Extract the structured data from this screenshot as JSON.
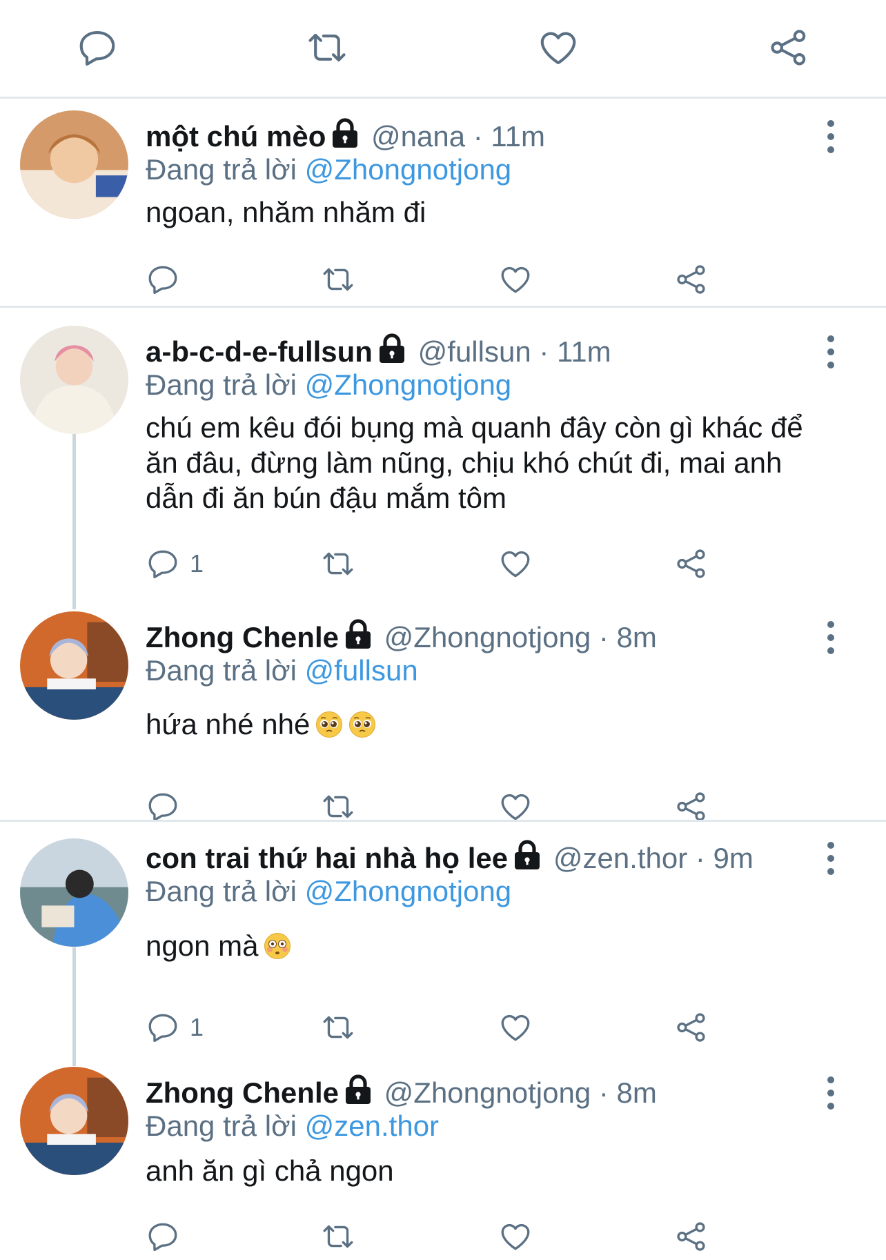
{
  "top_actions": [
    "reply-icon",
    "retweet-icon",
    "like-icon",
    "share-icon"
  ],
  "colors": {
    "mention": "#3d98e0",
    "muted": "#5b7083",
    "divider": "#e1e8ed",
    "text": "#14171a"
  },
  "replying_prefix": "Đang trả lời",
  "tweets": [
    {
      "name": "một chú mèo",
      "handle": "@nana",
      "time": "· 11m",
      "replying_to": "@Zhongnotjong",
      "text": "ngoan, nhăm nhăm đi",
      "reply_count": ""
    },
    {
      "name": "a-b-c-d-e-fullsun",
      "handle": "@fullsun",
      "time": "· 11m",
      "replying_to": "@Zhongnotjong",
      "text": "chú em kêu đói bụng mà quanh đây còn gì khác để ăn đâu, đừng làm nũng, chịu khó chút đi, mai anh dẫn đi ăn bún đậu mắm tôm",
      "reply_count": "1"
    },
    {
      "name": "Zhong Chenle",
      "handle": "@Zhongnotjong",
      "time": "· 8m",
      "replying_to": "@fullsun",
      "text": "hứa nhé nhé",
      "emoji": [
        "pleading-face-emoji",
        "pleading-face-emoji"
      ],
      "reply_count": ""
    },
    {
      "name": "con trai thứ hai nhà họ lee",
      "handle": "@zen.thor",
      "time": "· 9m",
      "replying_to": "@Zhongnotjong",
      "text": "ngon mà",
      "emoji": [
        "flushed-face-emoji"
      ],
      "reply_count": "1"
    },
    {
      "name": "Zhong Chenle",
      "handle": "@Zhongnotjong",
      "time": "· 8m",
      "replying_to": "@zen.thor",
      "text": "anh ăn gì chả ngon",
      "reply_count": ""
    }
  ]
}
